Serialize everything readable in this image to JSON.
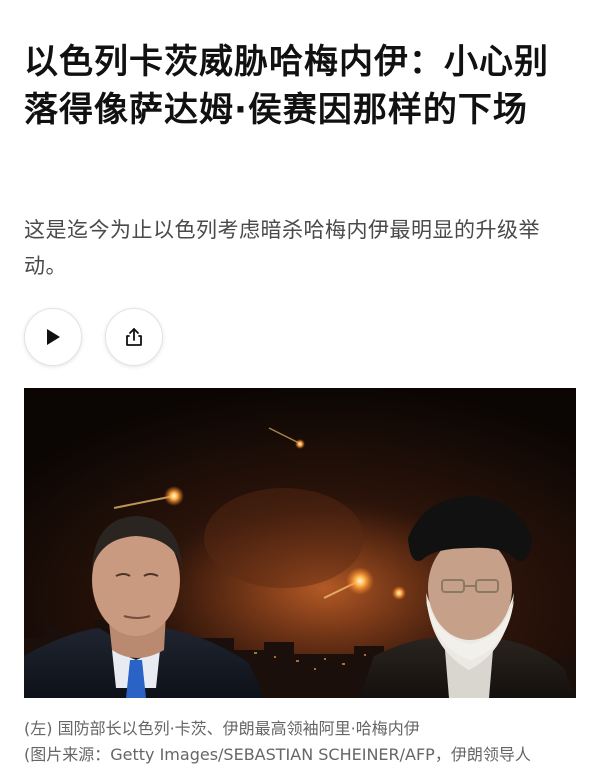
{
  "article": {
    "headline": "以色列卡茨威胁哈梅内伊：小心别落得像萨达姆·侯赛因那样的下场",
    "summary": "这是迄今为止以色列考虑暗杀哈梅内伊最明显的升级举动。"
  },
  "actions": {
    "play_icon": "play-icon",
    "share_icon": "share-icon"
  },
  "photo": {
    "caption": "(左) 国防部长以色列·卡茨、伊朗最高领袖阿里·哈梅内伊",
    "credit": "(图片来源：Getty Images/SEBASTIAN SCHEINER/AFP，伊朗领导人"
  }
}
